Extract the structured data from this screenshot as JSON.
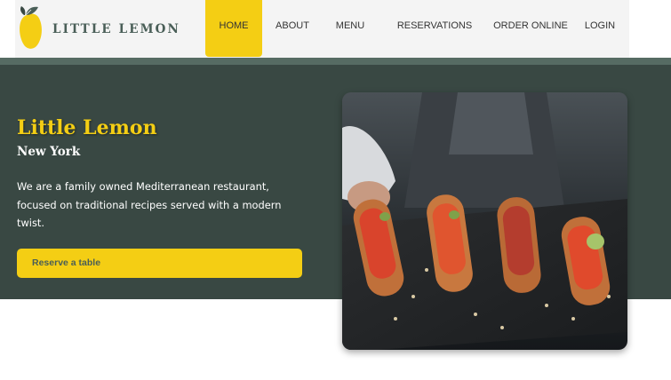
{
  "brand": {
    "name": "LITTLE LEMON"
  },
  "nav": {
    "items": [
      {
        "label": "HOME",
        "active": true
      },
      {
        "label": "ABOUT"
      },
      {
        "label": "MENU"
      },
      {
        "label": "RESERVATIONS"
      },
      {
        "label": "ORDER ONLINE"
      },
      {
        "label": "LOGIN"
      }
    ]
  },
  "hero": {
    "title": "Little Lemon",
    "subtitle": "New York",
    "description": "We are a family owned Mediterranean restaurant, focused on traditional recipes served with a modern twist.",
    "cta_label": "Reserve a table"
  },
  "colors": {
    "primary_green": "#495e57",
    "hero_bg": "#394843",
    "accent_yellow": "#f4ce14",
    "header_bg": "#f4f4f4"
  },
  "icons": [
    "lemon-logo-icon"
  ]
}
